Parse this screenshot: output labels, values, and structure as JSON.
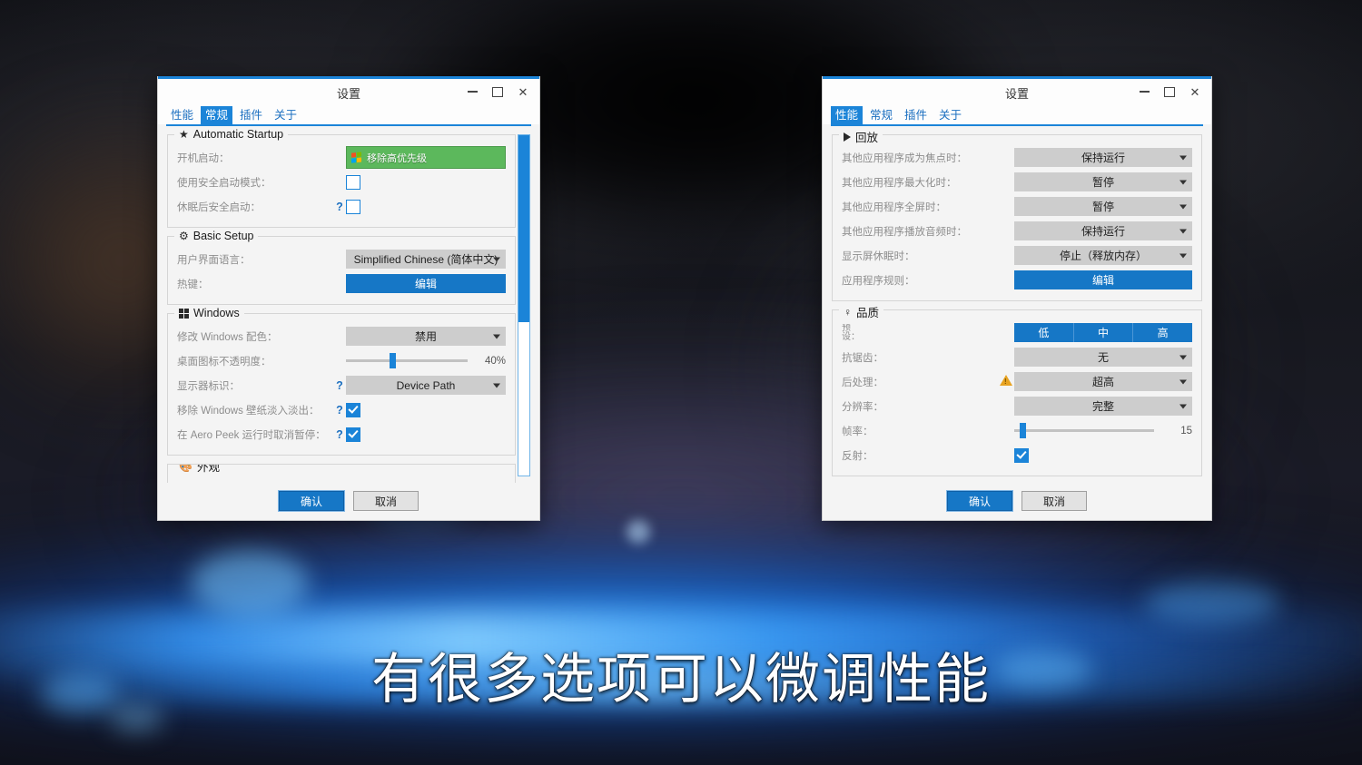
{
  "subtitle": "有很多选项可以微调性能",
  "common": {
    "window_title": "设置",
    "minimize": "minimize",
    "maximize": "maximize",
    "close": "close",
    "ok_label": "确认",
    "cancel_label": "取消",
    "help_mark": "?",
    "dropdown_caret": "▾"
  },
  "left_window": {
    "title": "设置",
    "tabs": [
      {
        "label": "性能",
        "active": false
      },
      {
        "label": "常规",
        "active": true
      },
      {
        "label": "插件",
        "active": false
      },
      {
        "label": "关于",
        "active": false
      }
    ],
    "groups": [
      {
        "icon": "star-icon",
        "title": "Automatic Startup",
        "rows": [
          {
            "label": "开机启动：",
            "help": false,
            "control": "green-button",
            "value": "移除高优先级"
          },
          {
            "label": "使用安全启动模式：",
            "help": false,
            "control": "checkbox",
            "checked": false
          },
          {
            "label": "休眠后安全启动：",
            "help": true,
            "control": "checkbox",
            "checked": false
          }
        ]
      },
      {
        "icon": "gear-icon",
        "title": "Basic Setup",
        "rows": [
          {
            "label": "用户界面语言：",
            "help": false,
            "control": "select",
            "value": "Simplified Chinese (简体中文)"
          },
          {
            "label": "热键：",
            "help": false,
            "control": "blue-button",
            "value": "编辑"
          }
        ]
      },
      {
        "icon": "windows-icon",
        "title": "Windows",
        "rows": [
          {
            "label": "修改 Windows 配色：",
            "help": false,
            "control": "select",
            "value": "禁用"
          },
          {
            "label": "桌面图标不透明度：",
            "help": false,
            "control": "slider",
            "value": "40%",
            "percent": 40
          },
          {
            "label": "显示器标识：",
            "help": true,
            "control": "select",
            "value": "Device Path"
          },
          {
            "label": "移除 Windows 壁纸淡入淡出：",
            "help": true,
            "control": "checkbox",
            "checked": true
          },
          {
            "label": "在 Aero Peek 运行时取消暂停：",
            "help": true,
            "control": "checkbox",
            "checked": true
          }
        ]
      },
      {
        "icon": "palette-icon",
        "title": "外观",
        "rows": []
      }
    ],
    "scrollbar": {
      "thumb_percent": 55
    },
    "ok_label": "确认",
    "cancel_label": "取消"
  },
  "right_window": {
    "title": "设置",
    "tabs": [
      {
        "label": "性能",
        "active": true
      },
      {
        "label": "常规",
        "active": false
      },
      {
        "label": "插件",
        "active": false
      },
      {
        "label": "关于",
        "active": false
      }
    ],
    "groups": [
      {
        "icon": "play-icon",
        "title": "回放",
        "rows": [
          {
            "label": "其他应用程序成为焦点时：",
            "control": "select",
            "value": "保持运行"
          },
          {
            "label": "其他应用程序最大化时：",
            "control": "select",
            "value": "暂停"
          },
          {
            "label": "其他应用程序全屏时：",
            "control": "select",
            "value": "暂停"
          },
          {
            "label": "其他应用程序播放音频时：",
            "control": "select",
            "value": "保持运行"
          },
          {
            "label": "显示屏休眠时：",
            "control": "select",
            "value": "停止（释放内存）"
          },
          {
            "label": "应用程序规则：",
            "control": "blue-button",
            "value": "编辑"
          }
        ]
      },
      {
        "icon": "quality-icon",
        "title": "品质",
        "rows": [
          {
            "label": "预\n设：",
            "control": "segmented",
            "options": [
              "低",
              "中",
              "高"
            ]
          },
          {
            "label": "抗锯齿：",
            "control": "select",
            "value": "无"
          },
          {
            "label": "后处理：",
            "control": "select",
            "value": "超高",
            "warning": true
          },
          {
            "label": "分辨率：",
            "control": "select",
            "value": "完整"
          },
          {
            "label": "帧率：",
            "control": "slider",
            "value": "15",
            "percent": 12
          },
          {
            "label": "反射：",
            "control": "checkbox",
            "checked": true
          }
        ]
      }
    ],
    "ok_label": "确认",
    "cancel_label": "取消"
  }
}
